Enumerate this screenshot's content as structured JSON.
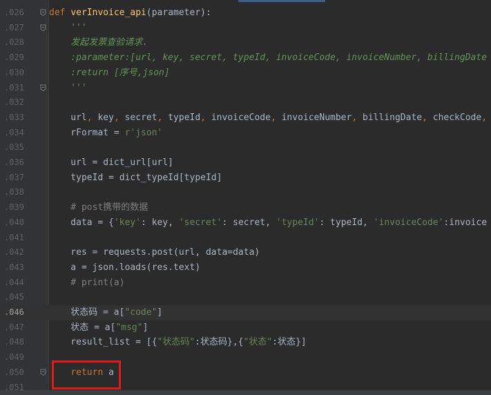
{
  "editor": {
    "lines": [
      {
        "num": ".026",
        "segments": [
          {
            "t": "def ",
            "c": "kw"
          },
          {
            "t": "verInvoice_api",
            "c": "fn"
          },
          {
            "t": "(parameter):",
            "c": "plain"
          }
        ],
        "fold": "minus"
      },
      {
        "num": ".027",
        "segments": [
          {
            "t": "    '''",
            "c": "doc"
          }
        ],
        "fold": "minus"
      },
      {
        "num": ".028",
        "segments": [
          {
            "t": "    发起发票查验请求.",
            "c": "doc"
          }
        ]
      },
      {
        "num": ".029",
        "segments": [
          {
            "t": "    :parameter:[url, key, secret, typeId, invoiceCode, invoiceNumber, billingDate",
            "c": "doc"
          }
        ]
      },
      {
        "num": ".030",
        "segments": [
          {
            "t": "    :return [序号,json]",
            "c": "doc"
          }
        ]
      },
      {
        "num": ".031",
        "segments": [
          {
            "t": "    '''",
            "c": "doc"
          }
        ],
        "fold": "minus"
      },
      {
        "num": ".032",
        "segments": []
      },
      {
        "num": ".033",
        "segments": [
          {
            "t": "    url",
            "c": "plain"
          },
          {
            "t": ", ",
            "c": "kw"
          },
          {
            "t": "key",
            "c": "plain"
          },
          {
            "t": ", ",
            "c": "kw"
          },
          {
            "t": "secret",
            "c": "plain"
          },
          {
            "t": ", ",
            "c": "kw"
          },
          {
            "t": "typeId",
            "c": "plain"
          },
          {
            "t": ", ",
            "c": "kw"
          },
          {
            "t": "invoiceCode",
            "c": "plain"
          },
          {
            "t": ", ",
            "c": "kw"
          },
          {
            "t": "invoiceNumber",
            "c": "plain"
          },
          {
            "t": ", ",
            "c": "kw"
          },
          {
            "t": "billingDate",
            "c": "plain"
          },
          {
            "t": ", ",
            "c": "kw"
          },
          {
            "t": "checkCode",
            "c": "plain"
          },
          {
            "t": ",",
            "c": "kw"
          }
        ]
      },
      {
        "num": ".034",
        "segments": [
          {
            "t": "    rFormat = ",
            "c": "plain"
          },
          {
            "t": "r'json'",
            "c": "str"
          }
        ]
      },
      {
        "num": ".035",
        "segments": []
      },
      {
        "num": ".036",
        "segments": [
          {
            "t": "    url = dict_url[url]",
            "c": "plain"
          }
        ]
      },
      {
        "num": ".037",
        "segments": [
          {
            "t": "    typeId = dict_typeId[typeId]",
            "c": "plain"
          }
        ]
      },
      {
        "num": ".038",
        "segments": []
      },
      {
        "num": ".039",
        "segments": [
          {
            "t": "    # post携带的数据",
            "c": "cmt"
          }
        ]
      },
      {
        "num": ".040",
        "segments": [
          {
            "t": "    data = {",
            "c": "plain"
          },
          {
            "t": "'key'",
            "c": "str"
          },
          {
            "t": ": key, ",
            "c": "plain"
          },
          {
            "t": "'secret'",
            "c": "str"
          },
          {
            "t": ": secret, ",
            "c": "plain"
          },
          {
            "t": "'typeId'",
            "c": "str"
          },
          {
            "t": ": typeId, ",
            "c": "plain"
          },
          {
            "t": "'invoiceCode'",
            "c": "str"
          },
          {
            "t": ":invoice",
            "c": "plain"
          }
        ]
      },
      {
        "num": ".041",
        "segments": []
      },
      {
        "num": ".042",
        "segments": [
          {
            "t": "    res = requests.post(url, data=data)",
            "c": "plain"
          }
        ]
      },
      {
        "num": ".043",
        "segments": [
          {
            "t": "    a = json.loads(res.text)",
            "c": "plain"
          }
        ]
      },
      {
        "num": ".044",
        "segments": [
          {
            "t": "    # print(a)",
            "c": "cmt"
          }
        ]
      },
      {
        "num": ".045",
        "segments": []
      },
      {
        "num": ".046",
        "segments": [
          {
            "t": "    状态码 = a[",
            "c": "plain"
          },
          {
            "t": "\"code\"",
            "c": "str"
          },
          {
            "t": "]",
            "c": "plain"
          }
        ],
        "current": true
      },
      {
        "num": ".047",
        "segments": [
          {
            "t": "    状态 = a[",
            "c": "plain"
          },
          {
            "t": "\"msg\"",
            "c": "str"
          },
          {
            "t": "]",
            "c": "plain"
          }
        ]
      },
      {
        "num": ".048",
        "segments": [
          {
            "t": "    result_list = [{",
            "c": "plain"
          },
          {
            "t": "\"状态码\"",
            "c": "str"
          },
          {
            "t": ":状态码},{",
            "c": "plain"
          },
          {
            "t": "\"状态\"",
            "c": "str"
          },
          {
            "t": ":状态}]",
            "c": "plain"
          }
        ]
      },
      {
        "num": ".049",
        "segments": []
      },
      {
        "num": ".050",
        "segments": [
          {
            "t": "    ",
            "c": "plain"
          },
          {
            "t": "return ",
            "c": "kw"
          },
          {
            "t": "a",
            "c": "plain"
          }
        ],
        "fold": "minus"
      },
      {
        "num": ".051",
        "segments": []
      }
    ]
  },
  "colors": {
    "background": "#2b2b2b",
    "gutter": "#313335",
    "keyword": "#cc7832",
    "function": "#ffc66d",
    "string": "#6a8759",
    "docstring": "#629755",
    "comment": "#808080",
    "highlight_box": "#e11a1a"
  },
  "icons": {
    "fold": "fold-minus-icon"
  }
}
